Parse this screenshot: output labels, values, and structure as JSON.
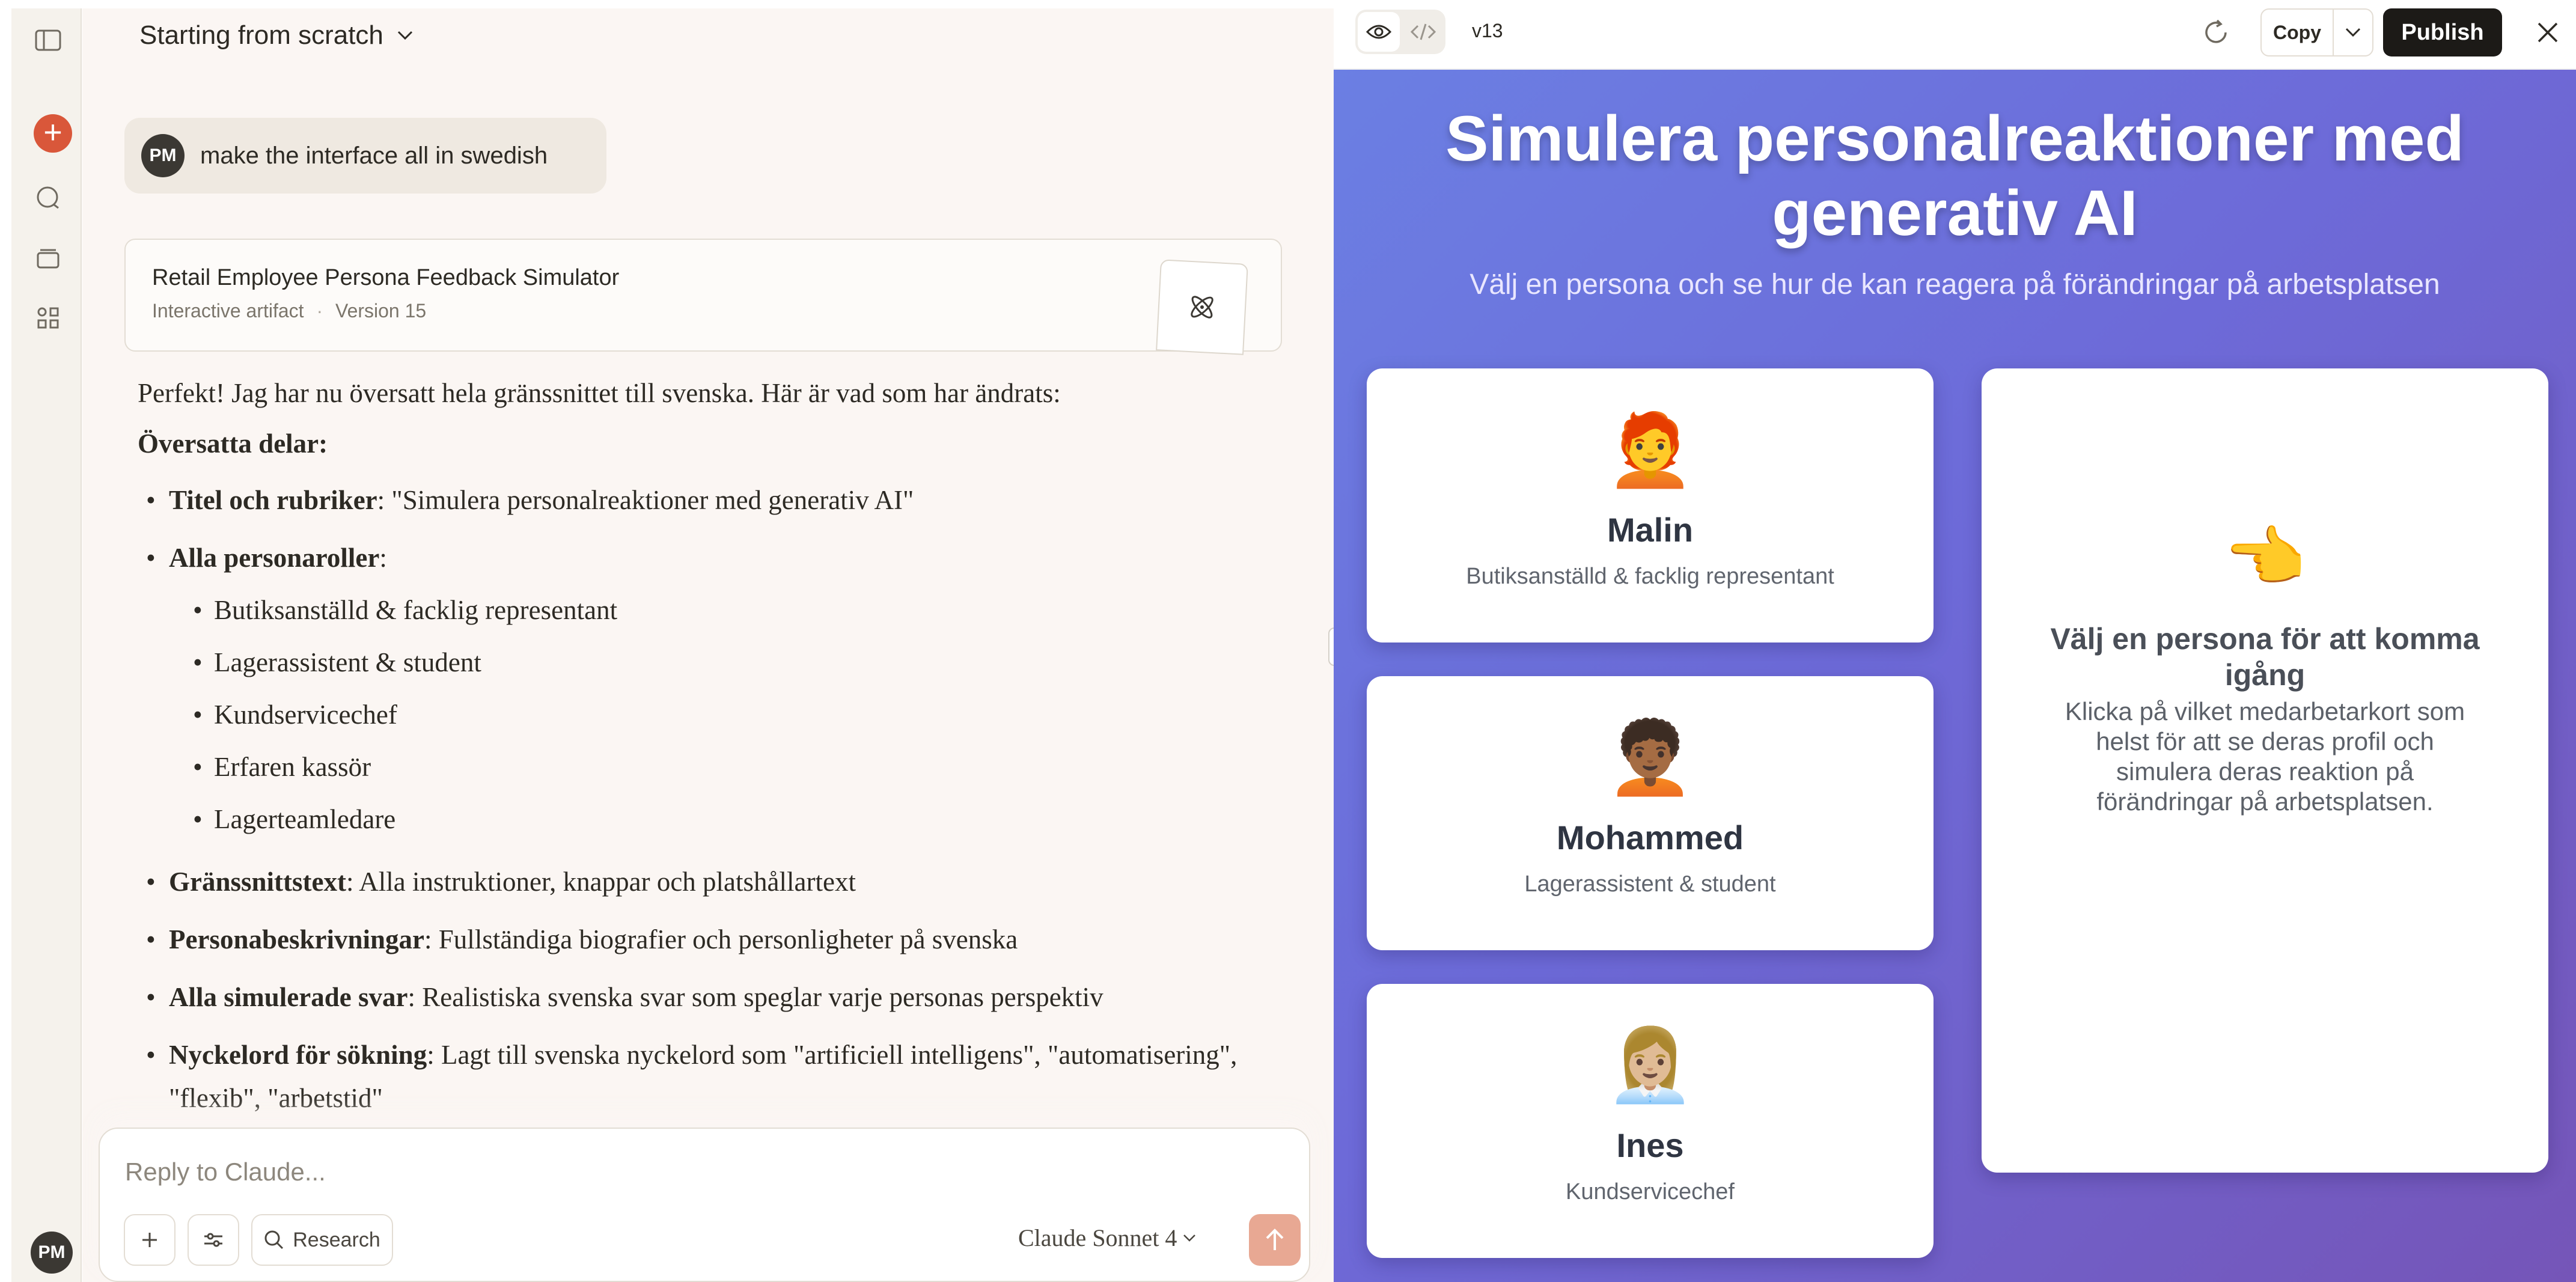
{
  "rail": {
    "avatar_initials": "PM",
    "icons": [
      "sidebar-toggle-icon",
      "new-chat-icon",
      "chats-icon",
      "projects-icon",
      "artifacts-icon"
    ]
  },
  "chat": {
    "title": "Starting from scratch",
    "user_message": {
      "avatar_initials": "PM",
      "text": "make the interface all in swedish"
    },
    "artifact": {
      "title": "Retail Employee Persona Feedback Simulator",
      "type": "Interactive artifact",
      "separator": "·",
      "version": "Version 15"
    },
    "reply": {
      "intro": "Perfekt! Jag har nu översatt hela gränssnittet till svenska. Här är vad som har ändrats:",
      "section_heading": "Översatta delar:",
      "bullets": [
        {
          "bold": "Titel och rubriker",
          "text": ": \"Simulera personalreaktioner med generativ AI\""
        },
        {
          "bold": "Alla personaroller",
          "text": ":"
        },
        {
          "bold": "Gränssnittstext",
          "text": ": Alla instruktioner, knappar och platshållartext"
        },
        {
          "bold": "Personabeskrivningar",
          "text": ": Fullständiga biografier och personligheter på svenska"
        },
        {
          "bold": "Alla simulerade svar",
          "text": ": Realistiska svenska svar som speglar varje personas perspektiv"
        },
        {
          "bold": "Nyckelord för sökning",
          "text": ": Lagt till svenska nyckelord som \"artificiell intelligens\", \"automatisering\", \"flexib\", \"arbetstid\""
        }
      ],
      "roles": [
        "Butiksanställd & facklig representant",
        "Lagerassistent & student",
        "Kundservicechef",
        "Erfaren kassör",
        "Lagerteamledare"
      ]
    },
    "composer": {
      "placeholder": "Reply to Claude...",
      "research_label": "Research",
      "model_brand": "Claude",
      "model_name": "Sonnet 4"
    }
  },
  "preview_toolbar": {
    "version": "v13",
    "copy_label": "Copy",
    "publish_label": "Publish"
  },
  "preview": {
    "title": "Simulera personalreaktioner med generativ AI",
    "subtitle": "Välj en persona och se hur de kan reagera på förändringar på arbetsplatsen",
    "personas": [
      {
        "emoji": "🧑‍🦰",
        "name": "Malin",
        "role": "Butiksanställd & facklig representant"
      },
      {
        "emoji": "🧑🏾‍🦱",
        "name": "Mohammed",
        "role": "Lagerassistent & student"
      },
      {
        "emoji": "👩🏼‍💼",
        "name": "Ines",
        "role": "Kundservicechef"
      }
    ],
    "info": {
      "emoji": "👈",
      "title": "Välj en persona för att komma igång",
      "text": "Klicka på vilket medarbetarkort som helst för att se deras profil och simulera deras reaktion på förändringar på arbetsplatsen."
    }
  },
  "colors": {
    "accent": "#d9573a",
    "send_button": "#e8a893",
    "publish_bg": "#1c1a17",
    "preview_gradient_start": "#6b7fe3",
    "preview_gradient_end": "#7555b8",
    "chat_bg": "#fbf6f3"
  }
}
